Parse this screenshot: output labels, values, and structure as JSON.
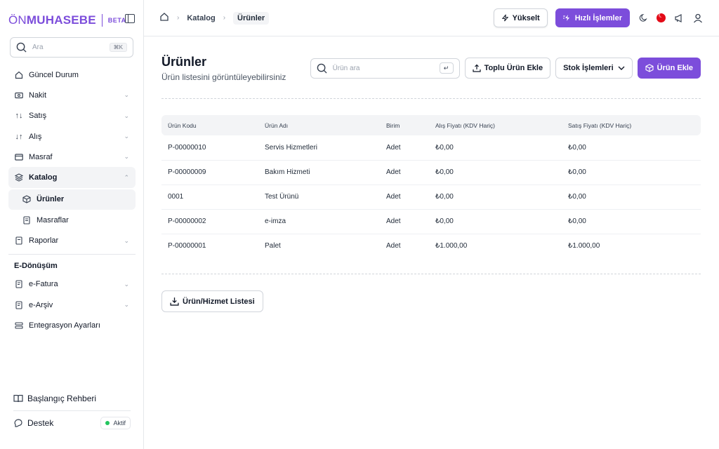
{
  "brand": {
    "name_light": "ÖN",
    "name_bold": "MUHASEBE",
    "badge": "BETA"
  },
  "sidebar": {
    "search_placeholder": "Ara",
    "search_shortcut": "⌘K",
    "items": [
      {
        "label": "Güncel Durum",
        "icon": "home-icon"
      },
      {
        "label": "Nakit",
        "icon": "cash-icon"
      },
      {
        "label": "Satış",
        "icon": "sales-arrows-icon"
      },
      {
        "label": "Alış",
        "icon": "purchase-arrows-icon"
      },
      {
        "label": "Masraf",
        "icon": "wallet-icon"
      },
      {
        "label": "Katalog",
        "icon": "layers-icon"
      },
      {
        "label": "Ürünler",
        "icon": "box-icon"
      },
      {
        "label": "Masraflar",
        "icon": "receipt-icon"
      },
      {
        "label": "Raporlar",
        "icon": "report-icon"
      }
    ],
    "section_title": "E-Dönüşüm",
    "edoc_items": [
      {
        "label": "e-Fatura",
        "icon": "invoice-icon"
      },
      {
        "label": "e-Arşiv",
        "icon": "archive-icon"
      },
      {
        "label": "Entegrasyon Ayarları",
        "icon": "integration-icon"
      }
    ],
    "bottom": {
      "guide_label": "Başlangıç Rehberi",
      "support_label": "Destek",
      "support_status": "Aktif"
    }
  },
  "topbar": {
    "breadcrumbs": [
      "Katalog",
      "Ürünler"
    ],
    "upgrade_label": "Yükselt",
    "quick_actions_label": "Hızlı İşlemler"
  },
  "page": {
    "title": "Ürünler",
    "subtitle": "Ürün listesini görüntüleyebilirsiniz",
    "search_placeholder": "Ürün ara",
    "bulk_add_label": "Toplu Ürün Ekle",
    "stock_ops_label": "Stok İşlemleri",
    "add_product_label": "Ürün Ekle",
    "export_label": "Ürün/Hizmet Listesi"
  },
  "table": {
    "columns": [
      "Ürün Kodu",
      "Ürün Adı",
      "Birim",
      "Alış Fiyatı (KDV Hariç)",
      "Satış Fiyatı (KDV Hariç)"
    ],
    "rows": [
      [
        "P-00000010",
        "Servis Hizmetleri",
        "Adet",
        "₺0,00",
        "₺0,00"
      ],
      [
        "P-00000009",
        "Bakım Hizmeti",
        "Adet",
        "₺0,00",
        "₺0,00"
      ],
      [
        "0001",
        "Test Ürünü",
        "Adet",
        "₺0,00",
        "₺0,00"
      ],
      [
        "P-00000002",
        "e-imza",
        "Adet",
        "₺0,00",
        "₺0,00"
      ],
      [
        "P-00000001",
        "Palet",
        "Adet",
        "₺1.000,00",
        "₺1.000,00"
      ]
    ]
  },
  "colors": {
    "accent": "#7c4ddb",
    "status_active": "#22c55e"
  }
}
